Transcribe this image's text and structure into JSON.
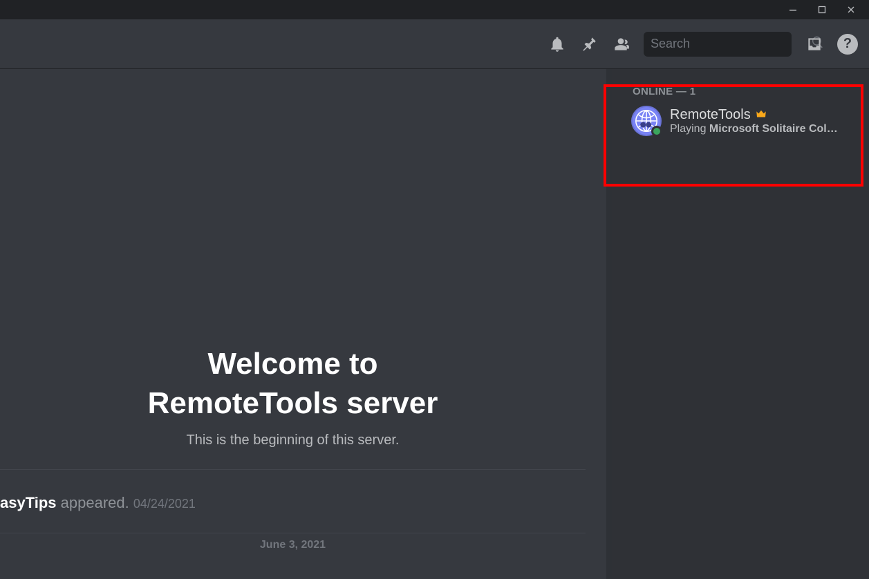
{
  "header": {
    "search_placeholder": "Search"
  },
  "welcome": {
    "title_line1": "Welcome to",
    "title_line2": "RemoteTools server",
    "subtitle": "This is the beginning of this server."
  },
  "first_message": {
    "username": "asyTips",
    "action": " appeared. ",
    "timestamp": "04/24/2021"
  },
  "divider_date": "June 3, 2021",
  "members": {
    "section_label": "ONLINE — 1",
    "list": [
      {
        "name": "RemoteTools",
        "activity_prefix": "Playing ",
        "activity_game": "Microsoft Solitaire Col…"
      }
    ]
  },
  "help_glyph": "?"
}
